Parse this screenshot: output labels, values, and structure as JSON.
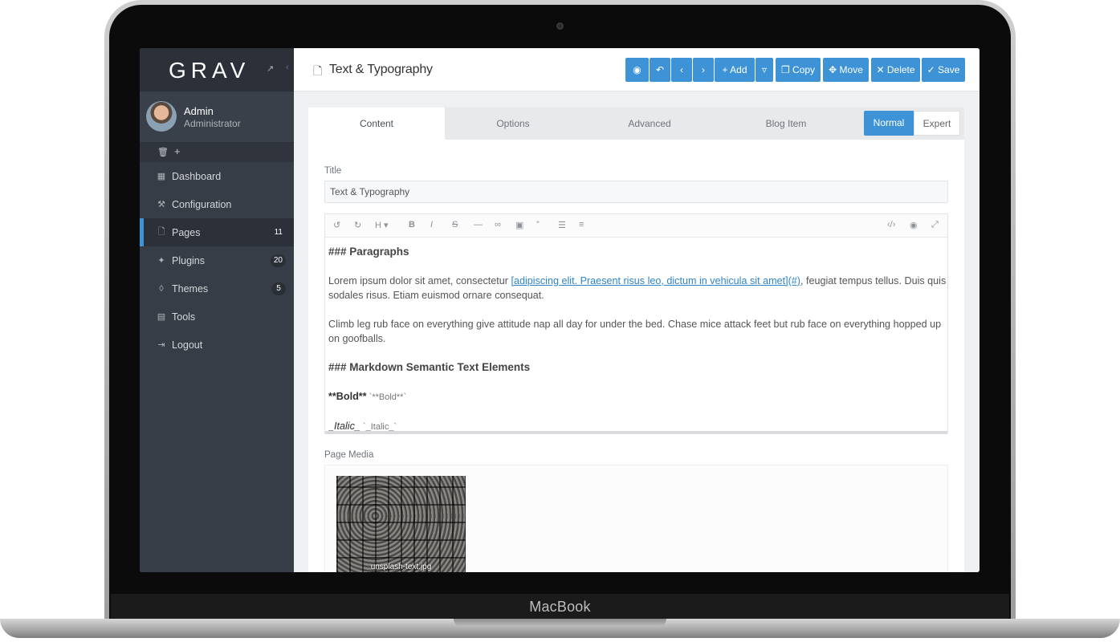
{
  "device": {
    "brand": "MacBook"
  },
  "sidebar": {
    "logo": "GRAV",
    "user": {
      "name": "Admin",
      "role": "Administrator"
    },
    "items": [
      {
        "label": "Dashboard",
        "icon": "dashboard-icon",
        "badge": ""
      },
      {
        "label": "Configuration",
        "icon": "wrench-icon",
        "badge": ""
      },
      {
        "label": "Pages",
        "icon": "file-icon",
        "badge": "11"
      },
      {
        "label": "Plugins",
        "icon": "plug-icon",
        "badge": "20"
      },
      {
        "label": "Themes",
        "icon": "tint-icon",
        "badge": "5"
      },
      {
        "label": "Tools",
        "icon": "briefcase-icon",
        "badge": ""
      },
      {
        "label": "Logout",
        "icon": "sign-out-icon",
        "badge": ""
      }
    ]
  },
  "header": {
    "title": "Text & Typography",
    "buttons": {
      "add": "Add",
      "copy": "Copy",
      "move": "Move",
      "delete": "Delete",
      "save": "Save"
    }
  },
  "tabs": [
    "Content",
    "Options",
    "Advanced",
    "Blog Item"
  ],
  "modes": {
    "normal": "Normal",
    "expert": "Expert"
  },
  "form": {
    "title_label": "Title",
    "title_value": "Text & Typography",
    "media_label": "Page Media"
  },
  "editor": {
    "heading1": "### Paragraphs",
    "p1_before": "Lorem ipsum dolor sit amet, consectetur ",
    "p1_link": "[adipiscing elit. Praesent risus leo, dictum in vehicula sit amet](#)",
    "p1_after": ", feugiat tempus tellus. Duis quis sodales risus. Etiam euismod ornare consequat.",
    "p2": "Climb leg rub face on everything give attitude nap all day for under the bed. Chase mice attack feet but rub face on everything hopped up on goofballs.",
    "heading2": "### Markdown Semantic Text Elements",
    "bold_marker": "**Bold**",
    "bold_code": " `**Bold**`",
    "italic_marker": "_Italic_",
    "italic_code": " `_Italic_`"
  },
  "media": {
    "filename": "unsplash-text.jpg"
  },
  "colors": {
    "accent": "#3d93d6",
    "sidebar": "#373d46",
    "sidebar_dark": "#2c3139"
  }
}
